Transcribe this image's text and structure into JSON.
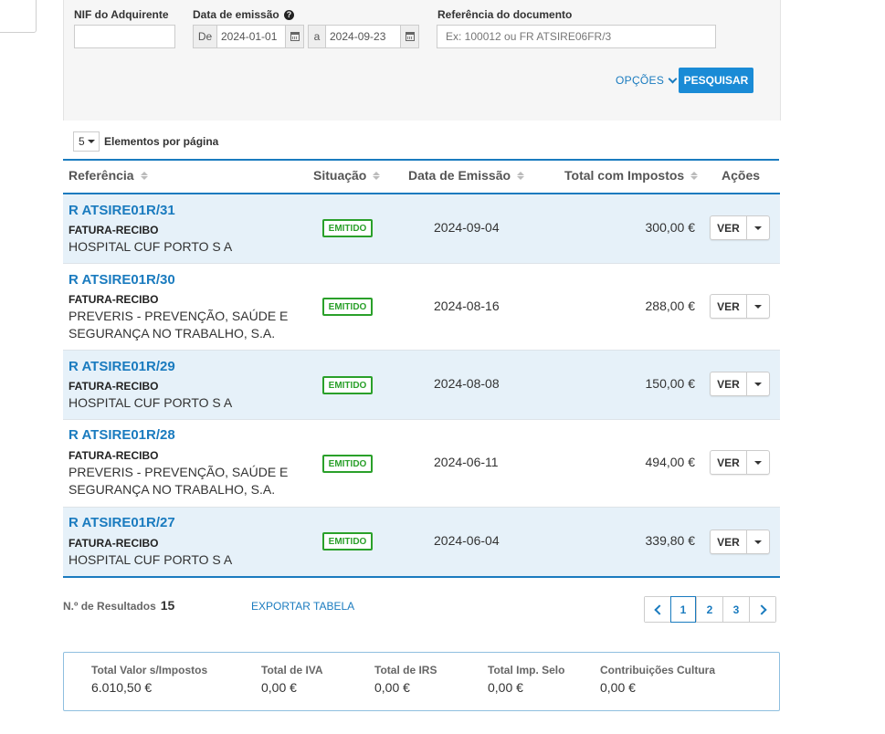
{
  "filters": {
    "nif_label": "NIF do Adquirente",
    "nif_value": "",
    "date_label": "Data de emissão",
    "date_help": "?",
    "date_from_prefix": "De",
    "date_from": "2024-01-01",
    "date_to_prefix": "a",
    "date_to": "2024-09-23",
    "ref_label": "Referência do documento",
    "ref_placeholder": "Ex: 100012 ou FR ATSIRE06FR/3",
    "options_label": "OPÇÕES",
    "search_label": "PESQUISAR"
  },
  "pagination_size": {
    "value": "5",
    "label": "Elementos por página"
  },
  "table": {
    "headers": {
      "ref": "Referência",
      "status": "Situação",
      "date": "Data de Emissão",
      "total": "Total com Impostos",
      "actions": "Ações"
    },
    "rows": [
      {
        "ref": "R ATSIRE01R/31",
        "type": "FATURA-RECIBO",
        "entity": "HOSPITAL CUF PORTO S A",
        "status": "EMITIDO",
        "date": "2024-09-04",
        "total": "300,00 €",
        "action": "VER"
      },
      {
        "ref": "R ATSIRE01R/30",
        "type": "FATURA-RECIBO",
        "entity": "PREVERIS - PREVENÇÃO, SAÚDE E SEGURANÇA NO TRABALHO, S.A.",
        "status": "EMITIDO",
        "date": "2024-08-16",
        "total": "288,00 €",
        "action": "VER"
      },
      {
        "ref": "R ATSIRE01R/29",
        "type": "FATURA-RECIBO",
        "entity": "HOSPITAL CUF PORTO S A",
        "status": "EMITIDO",
        "date": "2024-08-08",
        "total": "150,00 €",
        "action": "VER"
      },
      {
        "ref": "R ATSIRE01R/28",
        "type": "FATURA-RECIBO",
        "entity": "PREVERIS - PREVENÇÃO, SAÚDE E SEGURANÇA NO TRABALHO, S.A.",
        "status": "EMITIDO",
        "date": "2024-06-11",
        "total": "494,00 €",
        "action": "VER"
      },
      {
        "ref": "R ATSIRE01R/27",
        "type": "FATURA-RECIBO",
        "entity": "HOSPITAL CUF PORTO S A",
        "status": "EMITIDO",
        "date": "2024-06-04",
        "total": "339,80 €",
        "action": "VER"
      }
    ]
  },
  "footer": {
    "results_label": "N.º de Resultados",
    "results_count": "15",
    "export_label": "EXPORTAR TABELA",
    "pages": [
      "1",
      "2",
      "3"
    ],
    "current_page": "1"
  },
  "totals": {
    "no_tax_label": "Total Valor s/Impostos",
    "no_tax_value": "6.010,50 €",
    "iva_label": "Total de IVA",
    "iva_value": "0,00 €",
    "irs_label": "Total de IRS",
    "irs_value": "0,00 €",
    "stamp_label": "Total Imp. Selo",
    "stamp_value": "0,00 €",
    "culture_label": "Contribuições Cultura",
    "culture_value": "0,00 €"
  },
  "colors": {
    "accent": "#1a7bbf",
    "button": "#1a8bd6",
    "status_ok": "#2aa02a",
    "row_alt": "#e6f1f9"
  }
}
